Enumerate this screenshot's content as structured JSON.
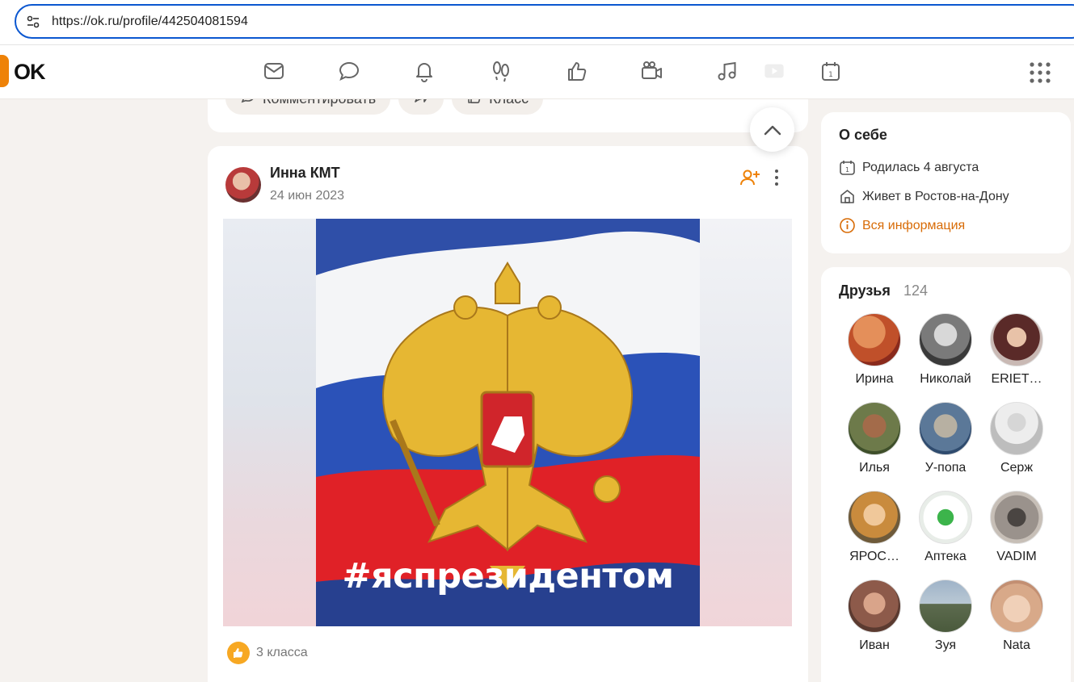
{
  "browser": {
    "url": "https://ok.ru/profile/442504081594"
  },
  "nav": {
    "logo_text": "OK",
    "brand_color": "#ee8208",
    "icons": [
      "mail-icon",
      "chat-icon",
      "bell-icon",
      "guests-icon",
      "like-icon",
      "video-icon",
      "music-icon",
      "play-icon",
      "calendar-icon",
      "apps-icon"
    ]
  },
  "prev_post": {
    "comment_label": "Комментировать",
    "share_label": "",
    "like_label": "Класс"
  },
  "post": {
    "author": "Инна КМТ",
    "date": "24 июн 2023",
    "image_caption": "#яспрезидентом",
    "likes_text": "3 класса"
  },
  "about": {
    "title": "О себе",
    "birthday": "Родилась 4 августа",
    "city": "Живет в Ростов-на-Дону",
    "all_info": "Вся информация",
    "accent_color": "#d86b06"
  },
  "friends": {
    "title": "Друзья",
    "count": "124",
    "items": [
      {
        "name": "Ирина"
      },
      {
        "name": "Николай"
      },
      {
        "name": "ERIET…"
      },
      {
        "name": "Илья"
      },
      {
        "name": "У-попа"
      },
      {
        "name": "Серж"
      },
      {
        "name": "ЯРОС…"
      },
      {
        "name": "Аптека"
      },
      {
        "name": "VADIM"
      },
      {
        "name": "Иван"
      },
      {
        "name": "Зуя"
      },
      {
        "name": "Nata"
      }
    ]
  }
}
